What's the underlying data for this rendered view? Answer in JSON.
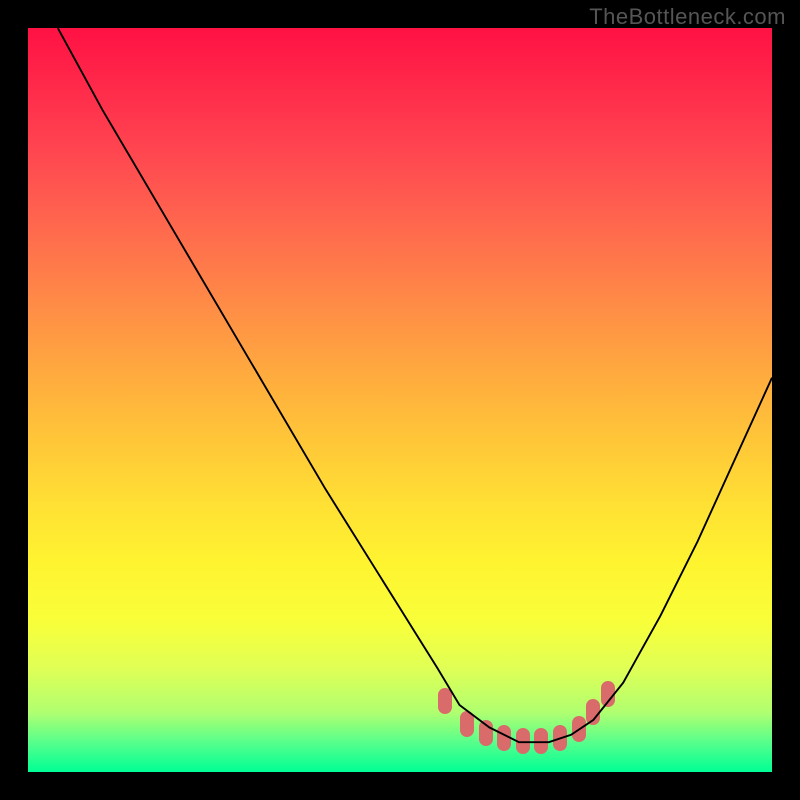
{
  "watermark": "TheBottleneck.com",
  "chart_data": {
    "type": "line",
    "title": "",
    "xlabel": "",
    "ylabel": "",
    "xlim": [
      0,
      100
    ],
    "ylim": [
      0,
      100
    ],
    "grid": false,
    "legend": false,
    "series": [
      {
        "name": "curve",
        "x": [
          4,
          10,
          20,
          30,
          40,
          50,
          55,
          58,
          62,
          66,
          70,
          73,
          76,
          80,
          85,
          90,
          95,
          100
        ],
        "y": [
          100,
          89,
          72,
          55,
          38,
          22,
          14,
          9,
          6,
          4,
          4,
          5,
          7,
          12,
          21,
          31,
          42,
          53
        ]
      }
    ],
    "markers": {
      "name": "highlighted range",
      "color": "#d96b6b",
      "points": [
        {
          "x": 56,
          "y": 9.5
        },
        {
          "x": 59,
          "y": 6.5
        },
        {
          "x": 61.5,
          "y": 5.2
        },
        {
          "x": 64,
          "y": 4.6
        },
        {
          "x": 66.5,
          "y": 4.2
        },
        {
          "x": 69,
          "y": 4.2
        },
        {
          "x": 71.5,
          "y": 4.6
        },
        {
          "x": 74,
          "y": 5.8
        },
        {
          "x": 76,
          "y": 8.0
        },
        {
          "x": 78,
          "y": 10.5
        }
      ]
    }
  }
}
